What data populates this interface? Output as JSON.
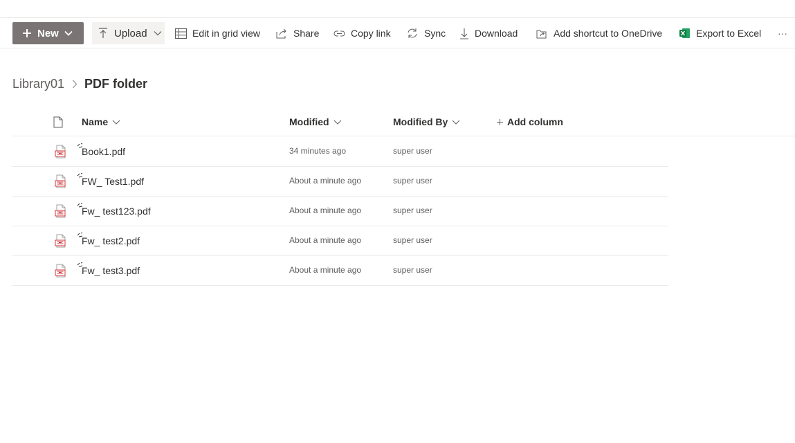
{
  "command_bar": {
    "new_label": "New",
    "upload_label": "Upload",
    "edit_grid_label": "Edit in grid view",
    "share_label": "Share",
    "copy_link_label": "Copy link",
    "sync_label": "Sync",
    "download_label": "Download",
    "add_shortcut_label": "Add shortcut to OneDrive",
    "export_excel_label": "Export to Excel",
    "more_label": "···"
  },
  "breadcrumb": {
    "library": "Library01",
    "current": "PDF folder"
  },
  "columns": {
    "name": "Name",
    "modified": "Modified",
    "modified_by": "Modified By",
    "add_column": "Add column"
  },
  "files": [
    {
      "name": "Book1.pdf",
      "modified": "34 minutes ago",
      "modified_by": "super user"
    },
    {
      "name": "FW_ Test1.pdf",
      "modified": "About a minute ago",
      "modified_by": "super user"
    },
    {
      "name": "Fw_ test123.pdf",
      "modified": "About a minute ago",
      "modified_by": "super user"
    },
    {
      "name": "Fw_ test2.pdf",
      "modified": "About a minute ago",
      "modified_by": "super user"
    },
    {
      "name": "Fw_ test3.pdf",
      "modified": "About a minute ago",
      "modified_by": "super user"
    }
  ],
  "icons": {
    "file_type": "pdf-file-icon",
    "new_item": "sparkle-new-icon",
    "excel": "excel-icon"
  },
  "colors": {
    "new_button_bg": "#7a7574",
    "pdf_red": "#d13438",
    "excel_green": "#107c41"
  }
}
